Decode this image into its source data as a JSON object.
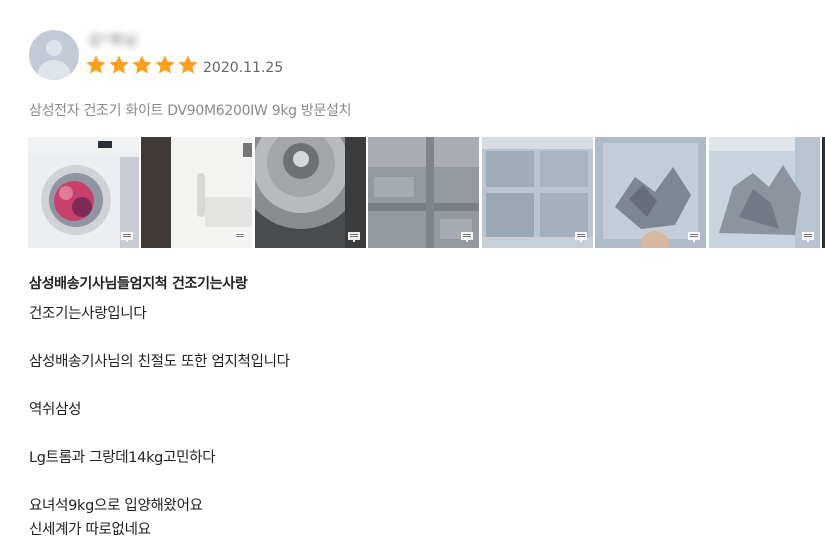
{
  "review": {
    "user_name": "김*희님",
    "rating": 5,
    "rating_max": 5,
    "date": "2020.11.25",
    "product_option": "삼성전자 건조기 화이트 DV90M6200IW 9kg 방문설치",
    "photos": [
      {
        "subject": "dryer-front",
        "badge_icon": "photo-badge-icon"
      },
      {
        "subject": "dryer-side",
        "badge_icon": "photo-badge-icon"
      },
      {
        "subject": "dryer-drum",
        "badge_icon": "photo-badge-icon"
      },
      {
        "subject": "lint-filter-closeup",
        "badge_icon": "photo-badge-icon"
      },
      {
        "subject": "lint-filter",
        "badge_icon": "photo-badge-icon"
      },
      {
        "subject": "lint-removal",
        "badge_icon": "photo-badge-icon"
      },
      {
        "subject": "lint-pile",
        "badge_icon": "photo-badge-icon"
      }
    ],
    "title": "삼성배송기사님들엄지척 건조기는사랑",
    "body_lines": [
      "건조기는사랑입니다",
      "",
      "삼성배송기사님의 친절도 또한 엄지척입니다",
      "",
      "역쉬삼성",
      "",
      "Lg트롬과 그랑데14kg고민하다",
      "",
      "요녀석9kg으로 입양해왔어요",
      "신세계가 따로없네요"
    ]
  },
  "colors": {
    "star": "#ff9f1a",
    "avatar": "#c3cad6",
    "meta_text": "#8a8a8a"
  }
}
